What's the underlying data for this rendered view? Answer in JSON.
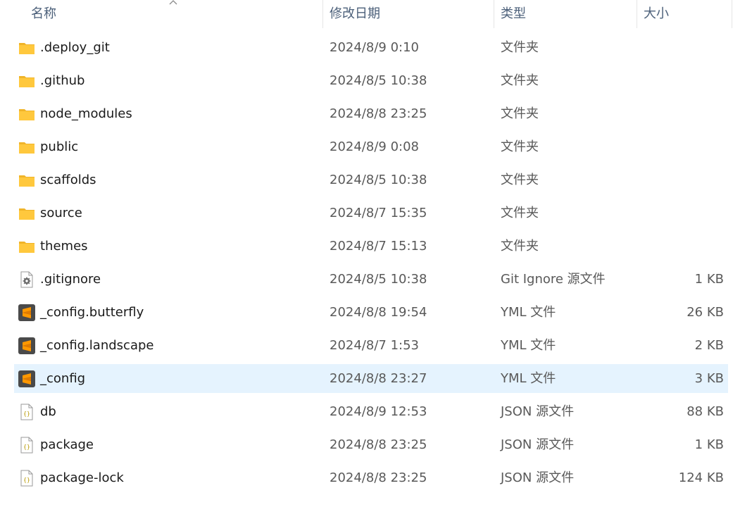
{
  "header": {
    "name": "名称",
    "date": "修改日期",
    "type": "类型",
    "size": "大小"
  },
  "colors": {
    "selected_row": "#e5f3fe",
    "folder": "#ffc83d",
    "sublime": "#ff9800",
    "json": "#c9b100"
  },
  "files": [
    {
      "icon": "folder-icon",
      "name": ".deploy_git",
      "date": "2024/8/9 0:10",
      "type": "文件夹",
      "size": ""
    },
    {
      "icon": "folder-icon",
      "name": ".github",
      "date": "2024/8/5 10:38",
      "type": "文件夹",
      "size": ""
    },
    {
      "icon": "folder-icon",
      "name": "node_modules",
      "date": "2024/8/8 23:25",
      "type": "文件夹",
      "size": ""
    },
    {
      "icon": "folder-icon",
      "name": "public",
      "date": "2024/8/9 0:08",
      "type": "文件夹",
      "size": ""
    },
    {
      "icon": "folder-icon",
      "name": "scaffolds",
      "date": "2024/8/5 10:38",
      "type": "文件夹",
      "size": ""
    },
    {
      "icon": "folder-icon",
      "name": "source",
      "date": "2024/8/7 15:35",
      "type": "文件夹",
      "size": ""
    },
    {
      "icon": "folder-icon",
      "name": "themes",
      "date": "2024/8/7 15:13",
      "type": "文件夹",
      "size": ""
    },
    {
      "icon": "settings-file-icon",
      "name": ".gitignore",
      "date": "2024/8/5 10:38",
      "type": "Git Ignore 源文件",
      "size": "1 KB"
    },
    {
      "icon": "sublime-file-icon",
      "name": "_config.butterfly",
      "date": "2024/8/8 19:54",
      "type": "YML 文件",
      "size": "26 KB"
    },
    {
      "icon": "sublime-file-icon",
      "name": "_config.landscape",
      "date": "2024/8/7 1:53",
      "type": "YML 文件",
      "size": "2 KB"
    },
    {
      "icon": "sublime-file-icon",
      "name": "_config",
      "date": "2024/8/8 23:27",
      "type": "YML 文件",
      "size": "3 KB",
      "selected": true
    },
    {
      "icon": "json-file-icon",
      "name": "db",
      "date": "2024/8/9 12:53",
      "type": "JSON 源文件",
      "size": "88 KB"
    },
    {
      "icon": "json-file-icon",
      "name": "package",
      "date": "2024/8/8 23:25",
      "type": "JSON 源文件",
      "size": "1 KB"
    },
    {
      "icon": "json-file-icon",
      "name": "package-lock",
      "date": "2024/8/8 23:25",
      "type": "JSON 源文件",
      "size": "124 KB"
    }
  ]
}
